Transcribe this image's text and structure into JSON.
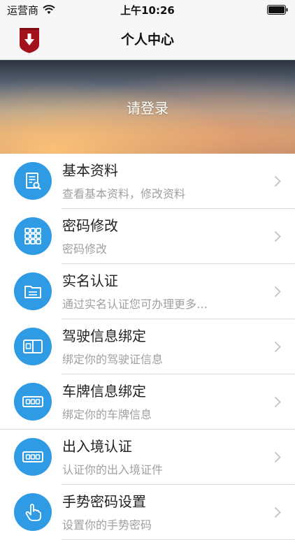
{
  "status_bar": {
    "carrier": "运营商",
    "time": "上午10:26"
  },
  "nav": {
    "title": "个人中心"
  },
  "banner": {
    "login_label": "请登录"
  },
  "menu": {
    "items": [
      {
        "title": "基本资料",
        "subtitle": "查看基本资料，修改资料",
        "icon": "document-search-icon"
      },
      {
        "title": "密码修改",
        "subtitle": "密码修改",
        "icon": "grid-keypad-icon"
      },
      {
        "title": "实名认证",
        "subtitle": "通过实名认证您可办理更多…",
        "icon": "folder-icon"
      },
      {
        "title": "驾驶信息绑定",
        "subtitle": "绑定你的驾驶证信息",
        "icon": "license-card-icon"
      },
      {
        "title": "车牌信息绑定",
        "subtitle": "绑定你的车牌信息",
        "icon": "license-plate-icon"
      },
      {
        "title": "出入境认证",
        "subtitle": "认证你的出入境证件",
        "icon": "license-plate-icon"
      },
      {
        "title": "手势密码设置",
        "subtitle": "设置你的手势密码",
        "icon": "hand-gesture-icon"
      }
    ]
  },
  "colors": {
    "accent": "#2f9be4",
    "logo_red": "#a3121c"
  }
}
